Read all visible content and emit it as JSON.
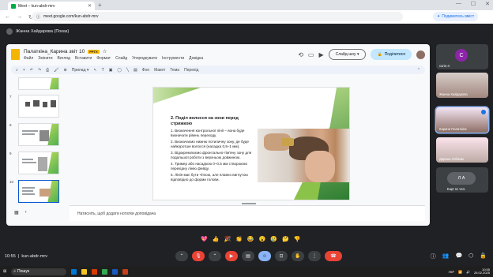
{
  "browser": {
    "tab_title": "Meet – kun-abdr-mrv",
    "url": "meet.google.com/kun-abdr-mrv",
    "translate_label": "Подивитись вміст"
  },
  "meet": {
    "presenter_label": "Жанна Хайдарова (Показ)",
    "time": "10:55",
    "meeting_code": "kun-abdr-mrv"
  },
  "slides": {
    "doc_title": "Палаткіна_Карина звіт 10",
    "badge": "PPTX",
    "menu": [
      "Файл",
      "Змінити",
      "Вигляд",
      "Вставити",
      "Формат",
      "Слайд",
      "Упорядкувати",
      "Інструменти",
      "Довідка"
    ],
    "slideshow_label": "Слайд-шоу",
    "share_label": "Поділитися",
    "toolbar": {
      "add_label": "Прилад",
      "bg_label": "Фон",
      "layout_label": "Макет",
      "theme_label": "Тема",
      "transition_label": "Перехід"
    },
    "thumbnail_numbers": [
      "7",
      "8",
      "9",
      "10"
    ],
    "notes_placeholder": "Натисніть, щоб додати нотатки доповідача"
  },
  "slide": {
    "title": "2. Поділ волосся на зони перед стрижкою",
    "points": [
      "1. Визначення контрольної лінії – вона буде визначати рівень переходу.",
      "2. Визначаємо нижню потиличну зону, де буде найкоротше волосся (насадка 0,5–1 мм).",
      "3. Відокремлюємо фронтально-тім'яну зону для подальшої роботи з верхньою довжиною.",
      "4. Тример або насадкою 0–0,5 мм створюємо перехідну лінію фейду.",
      "5. Лінія має бути чіткою, але плавно вигнутою відповідно до форми голови."
    ]
  },
  "participants": [
    {
      "name": "curio-4",
      "initial": "C",
      "color": "#8e24aa"
    },
    {
      "name": "Жанна Хайдарова",
      "initial": ""
    },
    {
      "name": "Карина Палаткіна",
      "initial": ""
    },
    {
      "name": "Дарина Олійник",
      "initial": ""
    },
    {
      "name": "Ещё 11 чел.",
      "initial": "Л  А"
    }
  ],
  "reactions": [
    "💖",
    "👍",
    "🎉",
    "👏",
    "😂",
    "😮",
    "😢",
    "🤔",
    "👎"
  ],
  "taskbar": {
    "search_label": "Пошук",
    "lang": "УКР",
    "clock_time": "10:55",
    "clock_date": "26.02.2025"
  }
}
